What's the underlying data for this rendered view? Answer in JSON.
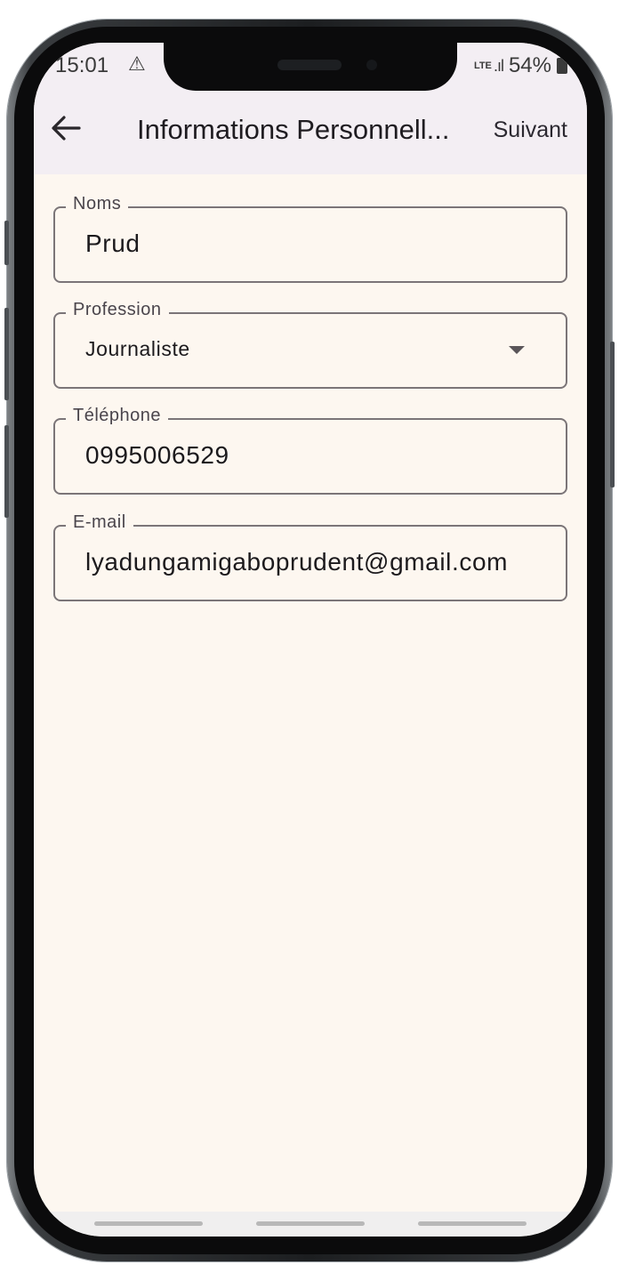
{
  "status_bar": {
    "time": "15:01",
    "network_label": "LTE",
    "battery": "54%"
  },
  "header": {
    "title": "Informations Personnell...",
    "next_label": "Suivant"
  },
  "form": {
    "names": {
      "label": "Noms",
      "value": "Prud"
    },
    "profession": {
      "label": "Profession",
      "value": "Journaliste"
    },
    "phone": {
      "label": "Téléphone",
      "value": "0995006529"
    },
    "email": {
      "label": "E-mail",
      "value": "lyadungamigaboprudent@gmail.com"
    }
  },
  "icons": {
    "back": "arrow-left-icon",
    "warning": "warning-icon",
    "signal": "signal-icon",
    "battery": "battery-charging-icon",
    "dropdown": "caret-down-icon"
  },
  "colors": {
    "appbar": "#f3eef3",
    "background": "#fdf7f0",
    "outline": "#7b7578"
  }
}
